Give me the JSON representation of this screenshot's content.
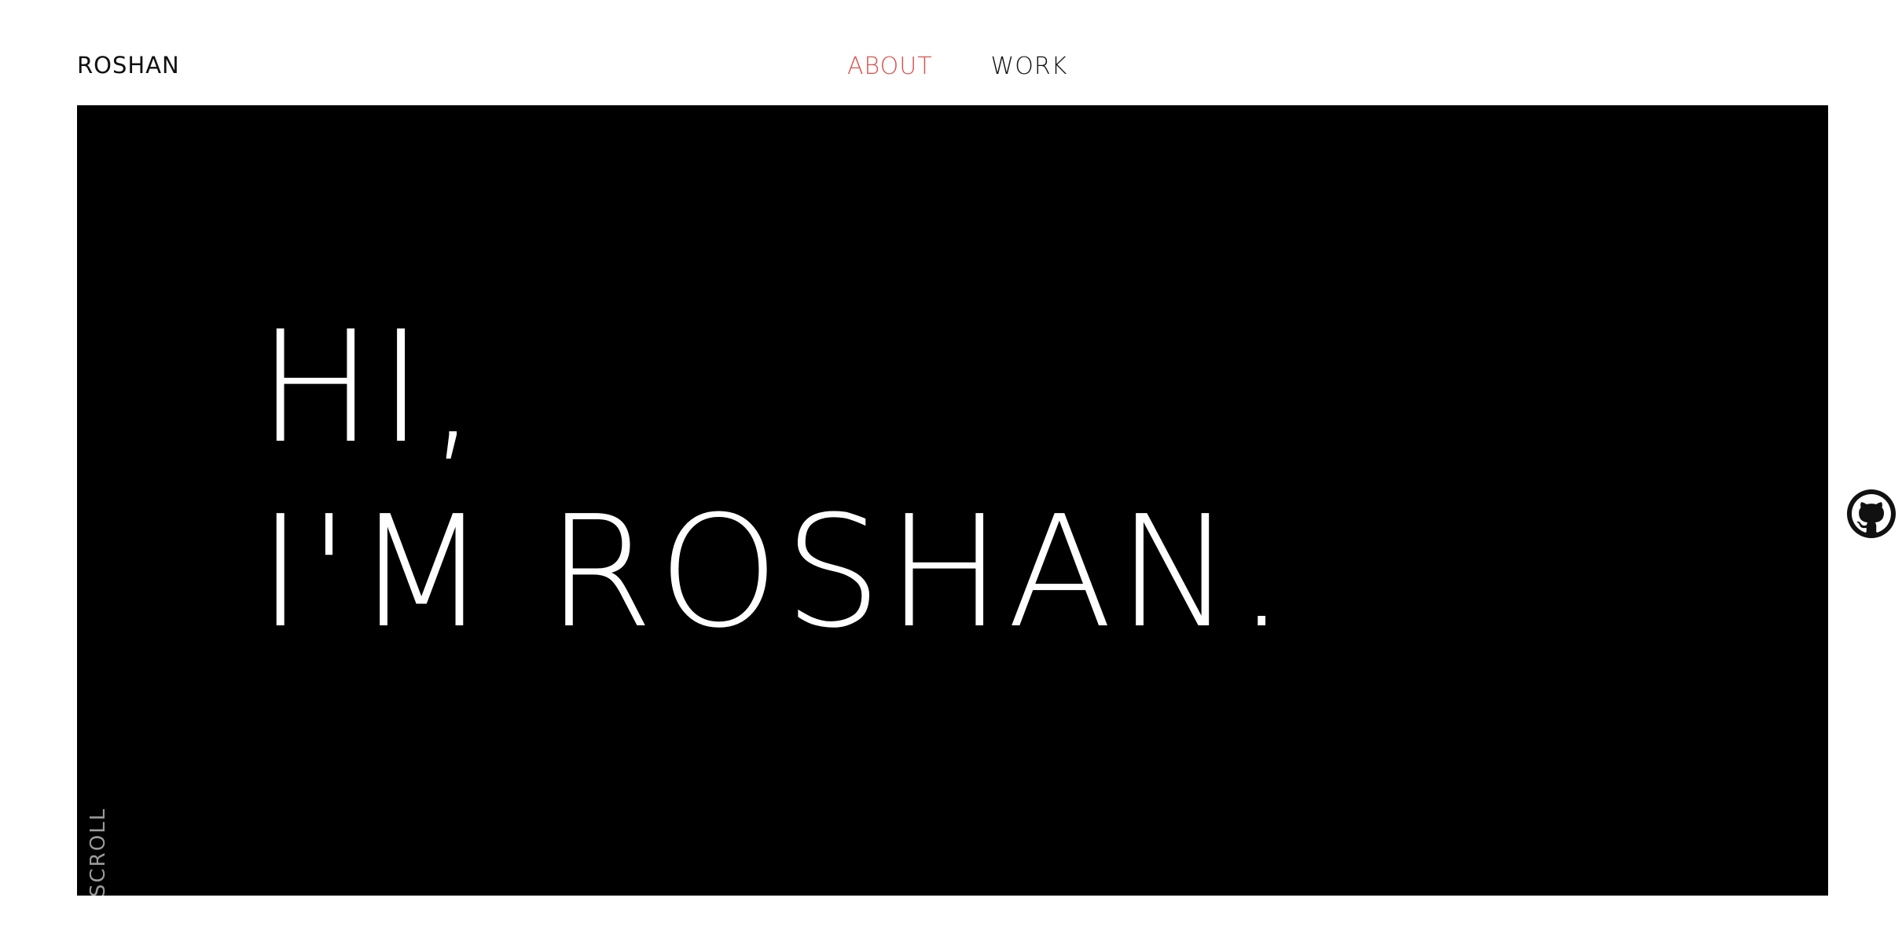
{
  "header": {
    "logo": "ROSHAN",
    "nav": [
      {
        "label": "ABOUT",
        "active": true
      },
      {
        "label": "WORK",
        "active": false
      }
    ]
  },
  "hero": {
    "line1": "HI,",
    "line2": "I'M ROSHAN.",
    "scroll_hint": "SCROLL"
  },
  "social": {
    "github_icon": "github-icon"
  },
  "colors": {
    "accent": "#d9534f",
    "hero_bg": "#000000",
    "text": "#111111"
  }
}
